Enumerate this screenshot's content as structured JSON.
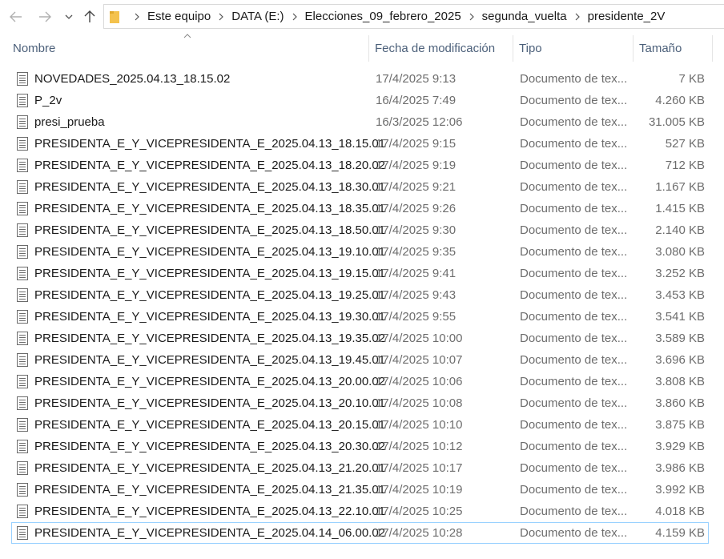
{
  "breadcrumb": [
    "Este equipo",
    "DATA (E:)",
    "Elecciones_09_febrero_2025",
    "segunda_vuelta",
    "presidente_2V"
  ],
  "columns": {
    "name": "Nombre",
    "date": "Fecha de modificación",
    "type": "Tipo",
    "size": "Tamaño"
  },
  "files": [
    {
      "name": "NOVEDADES_2025.04.13_18.15.02",
      "date": "17/4/2025 9:13",
      "type": "Documento de tex...",
      "size": "7 KB"
    },
    {
      "name": "P_2v",
      "date": "16/4/2025 7:49",
      "type": "Documento de tex...",
      "size": "4.260 KB"
    },
    {
      "name": "presi_prueba",
      "date": "16/3/2025 12:06",
      "type": "Documento de tex...",
      "size": "31.005 KB"
    },
    {
      "name": "PRESIDENTA_E_Y_VICEPRESIDENTA_E_2025.04.13_18.15.01",
      "date": "17/4/2025 9:15",
      "type": "Documento de tex...",
      "size": "527 KB"
    },
    {
      "name": "PRESIDENTA_E_Y_VICEPRESIDENTA_E_2025.04.13_18.20.02",
      "date": "17/4/2025 9:19",
      "type": "Documento de tex...",
      "size": "712 KB"
    },
    {
      "name": "PRESIDENTA_E_Y_VICEPRESIDENTA_E_2025.04.13_18.30.01",
      "date": "17/4/2025 9:21",
      "type": "Documento de tex...",
      "size": "1.167 KB"
    },
    {
      "name": "PRESIDENTA_E_Y_VICEPRESIDENTA_E_2025.04.13_18.35.01",
      "date": "17/4/2025 9:26",
      "type": "Documento de tex...",
      "size": "1.415 KB"
    },
    {
      "name": "PRESIDENTA_E_Y_VICEPRESIDENTA_E_2025.04.13_18.50.01",
      "date": "17/4/2025 9:30",
      "type": "Documento de tex...",
      "size": "2.140 KB"
    },
    {
      "name": "PRESIDENTA_E_Y_VICEPRESIDENTA_E_2025.04.13_19.10.01",
      "date": "17/4/2025 9:35",
      "type": "Documento de tex...",
      "size": "3.080 KB"
    },
    {
      "name": "PRESIDENTA_E_Y_VICEPRESIDENTA_E_2025.04.13_19.15.01",
      "date": "17/4/2025 9:41",
      "type": "Documento de tex...",
      "size": "3.252 KB"
    },
    {
      "name": "PRESIDENTA_E_Y_VICEPRESIDENTA_E_2025.04.13_19.25.01",
      "date": "17/4/2025 9:43",
      "type": "Documento de tex...",
      "size": "3.453 KB"
    },
    {
      "name": "PRESIDENTA_E_Y_VICEPRESIDENTA_E_2025.04.13_19.30.01",
      "date": "17/4/2025 9:55",
      "type": "Documento de tex...",
      "size": "3.541 KB"
    },
    {
      "name": "PRESIDENTA_E_Y_VICEPRESIDENTA_E_2025.04.13_19.35.02",
      "date": "17/4/2025 10:00",
      "type": "Documento de tex...",
      "size": "3.589 KB"
    },
    {
      "name": "PRESIDENTA_E_Y_VICEPRESIDENTA_E_2025.04.13_19.45.01",
      "date": "17/4/2025 10:07",
      "type": "Documento de tex...",
      "size": "3.696 KB"
    },
    {
      "name": "PRESIDENTA_E_Y_VICEPRESIDENTA_E_2025.04.13_20.00.02",
      "date": "17/4/2025 10:06",
      "type": "Documento de tex...",
      "size": "3.808 KB"
    },
    {
      "name": "PRESIDENTA_E_Y_VICEPRESIDENTA_E_2025.04.13_20.10.01",
      "date": "17/4/2025 10:08",
      "type": "Documento de tex...",
      "size": "3.860 KB"
    },
    {
      "name": "PRESIDENTA_E_Y_VICEPRESIDENTA_E_2025.04.13_20.15.01",
      "date": "17/4/2025 10:10",
      "type": "Documento de tex...",
      "size": "3.875 KB"
    },
    {
      "name": "PRESIDENTA_E_Y_VICEPRESIDENTA_E_2025.04.13_20.30.02",
      "date": "17/4/2025 10:12",
      "type": "Documento de tex...",
      "size": "3.929 KB"
    },
    {
      "name": "PRESIDENTA_E_Y_VICEPRESIDENTA_E_2025.04.13_21.20.01",
      "date": "17/4/2025 10:17",
      "type": "Documento de tex...",
      "size": "3.986 KB"
    },
    {
      "name": "PRESIDENTA_E_Y_VICEPRESIDENTA_E_2025.04.13_21.35.01",
      "date": "17/4/2025 10:19",
      "type": "Documento de tex...",
      "size": "3.992 KB"
    },
    {
      "name": "PRESIDENTA_E_Y_VICEPRESIDENTA_E_2025.04.13_22.10.01",
      "date": "17/4/2025 10:25",
      "type": "Documento de tex...",
      "size": "4.018 KB"
    },
    {
      "name": "PRESIDENTA_E_Y_VICEPRESIDENTA_E_2025.04.14_06.00.02",
      "date": "17/4/2025 10:28",
      "type": "Documento de tex...",
      "size": "4.159 KB",
      "selected": true
    }
  ],
  "colors": {
    "header_text": "#4c607a",
    "secondary_text": "#6d6d6d",
    "selection_border": "#99d1ff",
    "folder": "#f4c24d"
  },
  "icons": {
    "back": "arrow-left-icon",
    "forward": "arrow-right-icon",
    "recent": "chevron-down-icon",
    "up": "arrow-up-icon",
    "folder": "folder-icon",
    "file": "text-document-icon",
    "sort": "sort-ascending-icon"
  }
}
